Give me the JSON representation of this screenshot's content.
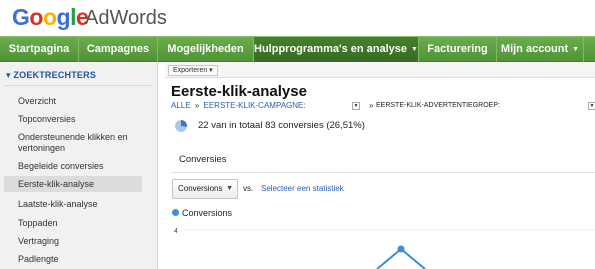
{
  "header": {
    "logo_word": "Google",
    "product": "AdWords"
  },
  "nav": {
    "items": [
      {
        "label": "Startpagina"
      },
      {
        "label": "Campagnes"
      },
      {
        "label": "Mogelijkheden"
      },
      {
        "label": "Hulpprogramma's en analyse",
        "caret": "▼"
      },
      {
        "label": "Facturering"
      },
      {
        "label": "Mijn account",
        "caret": "▼"
      }
    ]
  },
  "sidebar": {
    "header": "▾ ZOEKTRECHTERS",
    "items": [
      {
        "label": "Overzicht"
      },
      {
        "label": "Topconversies"
      },
      {
        "label": "Ondersteunende klikken en vertoningen"
      },
      {
        "label": "Begeleide conversies"
      },
      {
        "label": "Eerste-klik-analyse"
      },
      {
        "label": "Laatste-klik-analyse"
      },
      {
        "label": "Toppaden"
      },
      {
        "label": "Vertraging"
      },
      {
        "label": "Padlengte"
      }
    ]
  },
  "main": {
    "toolbar": {
      "export_label": "Exporteren ▾"
    },
    "title": "Eerste-klik-analyse",
    "breadcrumb": {
      "all": "ALLE",
      "separator": "»",
      "campaign": "EERSTE-KLIK-CAMPAGNE:",
      "adgroup": "EERSTE-KLIK-ADVERTENTIEGROEP:"
    },
    "summary": "22 van in totaal 83 conversies (26,51%)",
    "conversions_heading": "Conversies",
    "metric_select": {
      "value": "Conversions"
    },
    "vs_label": "vs.",
    "select_stat_link": "Selecteer een statistiek",
    "legend_label": "Conversions",
    "y_axis_top_label": "4"
  },
  "chart_data": {
    "type": "line",
    "series": [
      {
        "name": "Conversions"
      }
    ],
    "visible_y_tick": "4",
    "colors": {
      "series": "#3b8fd6"
    }
  },
  "colors": {
    "nav_green": "#5aa13f",
    "link_blue": "#2a5db0",
    "sidebar_header_blue": "#2152a3"
  }
}
